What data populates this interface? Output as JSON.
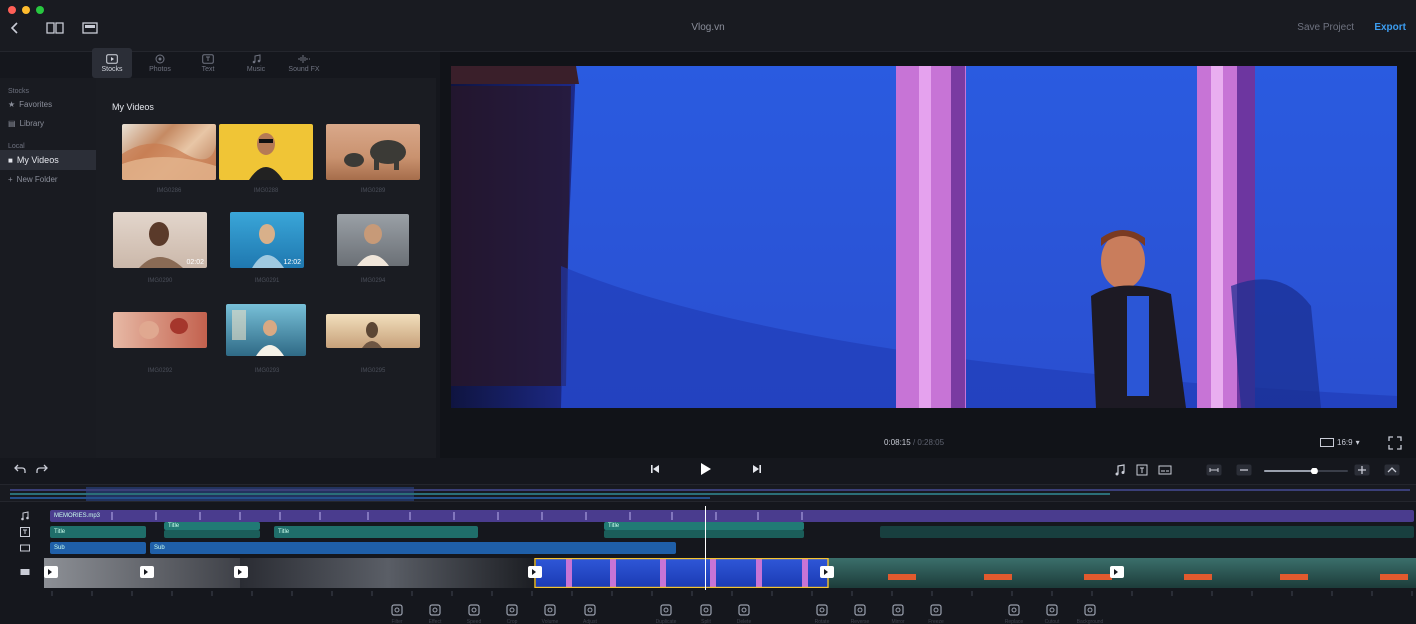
{
  "window": {
    "title": "Vlog.vn",
    "save_label": "Save Project",
    "export_label": "Export"
  },
  "media_tabs": [
    {
      "label": "Stocks",
      "icon": "stocks-icon",
      "active": true
    },
    {
      "label": "Photos",
      "icon": "photos-icon",
      "active": false
    },
    {
      "label": "Text",
      "icon": "text-icon",
      "active": false
    },
    {
      "label": "Music",
      "icon": "music-icon",
      "active": false
    },
    {
      "label": "Sound FX",
      "icon": "sound-fx-icon",
      "active": false
    }
  ],
  "sidebar": {
    "stocks_section": "Stocks",
    "favorites": "Favorites",
    "library": "Library",
    "local_section": "Local",
    "my_videos": "My Videos",
    "new_folder": "New Folder"
  },
  "library": {
    "title": "My Videos",
    "items": [
      {
        "caption": "IMG0286",
        "duration": ""
      },
      {
        "caption": "IMG0288",
        "duration": ""
      },
      {
        "caption": "IMG0289",
        "duration": ""
      },
      {
        "caption": "IMG0290",
        "duration": "02:02"
      },
      {
        "caption": "IMG0291",
        "duration": "12:02"
      },
      {
        "caption": "IMG0294",
        "duration": ""
      },
      {
        "caption": "IMG0292",
        "duration": ""
      },
      {
        "caption": "IMG0293",
        "duration": ""
      },
      {
        "caption": "IMG0295",
        "duration": ""
      }
    ]
  },
  "preview": {
    "timecode": "0:08:15",
    "total": "/ 0:28:05",
    "aspect": "16:9"
  },
  "timeline": {
    "music_clip_label": "MEMORIES.mp3",
    "text_clips": [
      "Title",
      "Title",
      "Title",
      "Title"
    ],
    "caption_clips": [
      "Sub",
      "Sub"
    ],
    "zoom_level": 0.6
  },
  "bottom_toolbar": [
    {
      "label": "Filter",
      "icon": "filter-icon"
    },
    {
      "label": "Effect",
      "icon": "effect-icon"
    },
    {
      "label": "Speed",
      "icon": "speed-icon"
    },
    {
      "label": "Crop",
      "icon": "crop-icon"
    },
    {
      "label": "Volume",
      "icon": "volume-icon"
    },
    {
      "label": "Adjust",
      "icon": "adjust-icon"
    },
    {
      "label": "Duplicate",
      "icon": "duplicate-icon"
    },
    {
      "label": "Split",
      "icon": "scissors-icon"
    },
    {
      "label": "Delete",
      "icon": "delete-icon"
    },
    {
      "label": "Rotate",
      "icon": "rotate-icon"
    },
    {
      "label": "Reverse",
      "icon": "reverse-icon"
    },
    {
      "label": "Mirror",
      "icon": "mirror-icon"
    },
    {
      "label": "Freeze",
      "icon": "freeze-icon"
    },
    {
      "label": "Replace",
      "icon": "replace-icon"
    },
    {
      "label": "Cutout",
      "icon": "cutout-icon"
    },
    {
      "label": "Background",
      "icon": "background-icon"
    }
  ]
}
